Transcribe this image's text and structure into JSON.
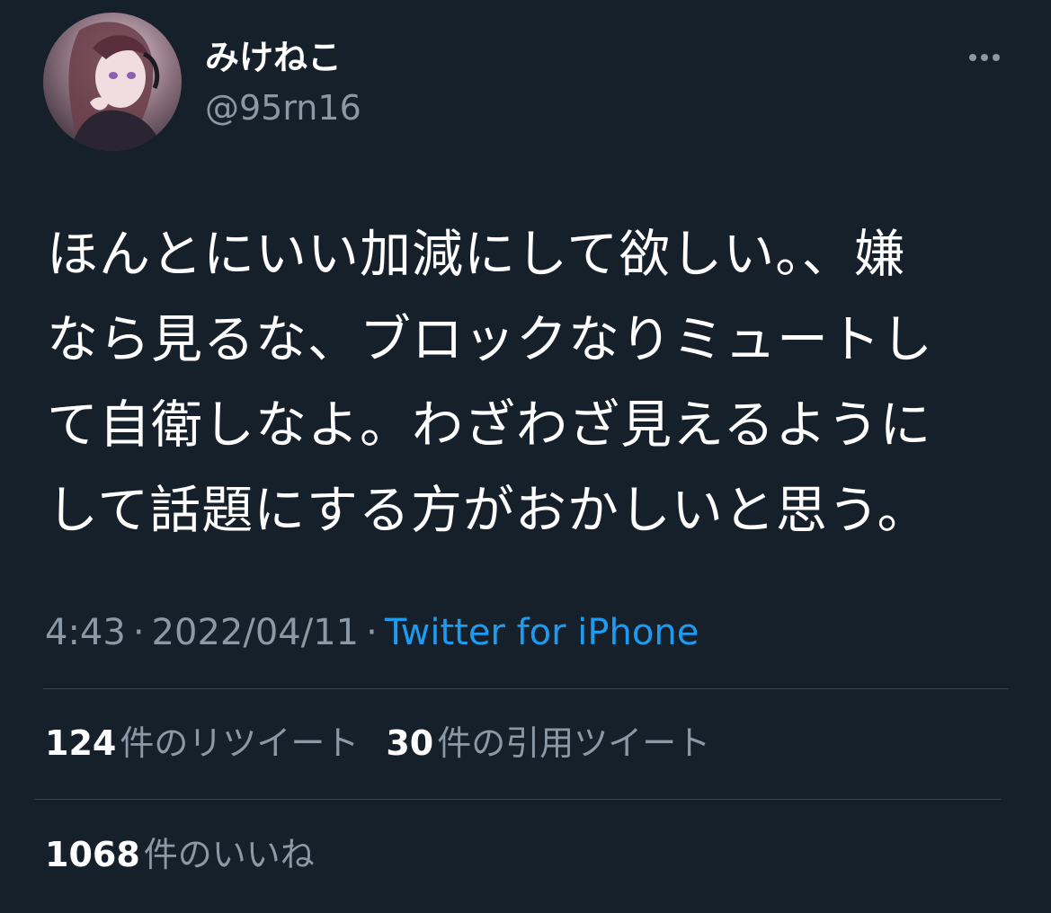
{
  "user": {
    "display_name": "みけねこ",
    "handle": "@95rn16"
  },
  "icons": {
    "more": "more-horizontal-icon",
    "avatar": "profile-avatar"
  },
  "tweet": {
    "lines": [
      "ほんとにいい加減にして欲しい。、嫌",
      "なら見るな、ブロックなりミュートし",
      "て自衛しなよ。わざわざ見えるように",
      "して話題にする方がおかしいと思う。"
    ],
    "time": "4:43",
    "date": "2022/04/11",
    "separator": "·",
    "source": "Twitter for iPhone"
  },
  "stats": {
    "retweets": {
      "count": "124",
      "label": "件のリツイート"
    },
    "quotes": {
      "count": "30",
      "label": "件の引用ツイート"
    },
    "likes": {
      "count": "1068",
      "label": "件のいいね"
    }
  },
  "colors": {
    "background": "#15202b",
    "text": "#ffffff",
    "secondary_text": "#8b98a5",
    "link": "#1d9bf0",
    "divider": "#38444d"
  }
}
